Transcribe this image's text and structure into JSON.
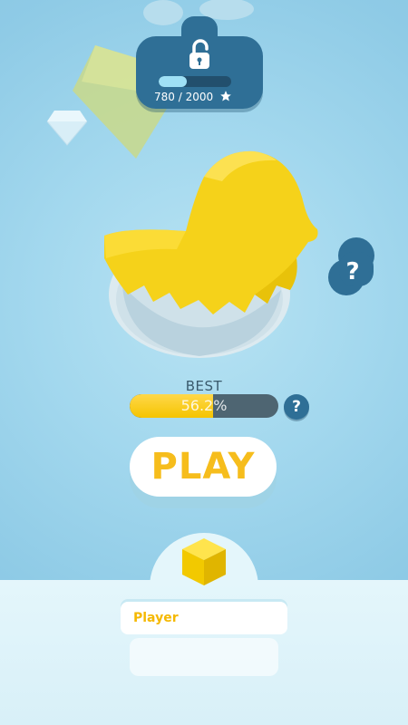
{
  "unlock": {
    "progress_text": "780 / 2000",
    "current": 780,
    "total": 2000,
    "icon": "lock-open-icon",
    "unit_icon": "star-icon"
  },
  "best": {
    "label": "BEST",
    "percent_text": "56.2%",
    "percent": 56.2,
    "help_label": "?"
  },
  "hint": {
    "label": "?"
  },
  "play": {
    "label": "PLAY"
  },
  "player": {
    "name": "Player"
  },
  "colors": {
    "accent_yellow": "#f6bd1c",
    "panel_blue": "#2f6f96",
    "background": "#a3d8ee",
    "bar_track": "#4e6572"
  }
}
